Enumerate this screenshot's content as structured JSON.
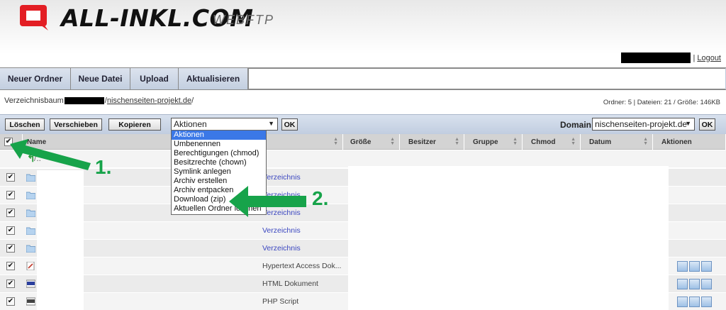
{
  "brand": {
    "name": "ALL-INKL.COM",
    "product": "WEBFTP",
    "accent": "#e31e24"
  },
  "user": {
    "separator": "|",
    "logout": "Logout"
  },
  "toolbar": [
    {
      "label": "Neuer Ordner"
    },
    {
      "label": "Neue Datei"
    },
    {
      "label": "Upload"
    },
    {
      "label": "Aktualisieren"
    }
  ],
  "path": {
    "prefix": "Verzeichnisbaum",
    "separator": "/",
    "folder": "nischenseiten-projekt.de",
    "trailing": "/"
  },
  "stats": "Ordner: 5 | Dateien: 21 / Größe: 146KB",
  "actions": {
    "delete": "Löschen",
    "move": "Verschieben",
    "copy": "Kopieren",
    "select_value": "Aktionen",
    "ok": "OK",
    "domain_label": "Domain:",
    "domain_value": "nischenseiten-projekt.de",
    "domain_ok": "OK"
  },
  "dropdown": {
    "options": [
      "Aktionen",
      "Umbenennen",
      "Berechtigungen (chmod)",
      "Besitzrechte (chown)",
      "Symlink anlegen",
      "Archiv erstellen",
      "Archiv entpacken",
      "Download (zip)",
      "Aktuellen Ordner löschen"
    ],
    "selected_index": 0
  },
  "columns": [
    "Name",
    "Größe",
    "Besitzer",
    "Gruppe",
    "Chmod",
    "Datum",
    "Aktionen"
  ],
  "up_row": "/..",
  "rows": [
    {
      "type": "Verzeichnis",
      "icon": "folder-icon",
      "link": true,
      "checked": true
    },
    {
      "type": "Verzeichnis",
      "icon": "folder-icon",
      "link": true,
      "checked": true
    },
    {
      "type": "Verzeichnis",
      "icon": "folder-icon",
      "link": true,
      "checked": true
    },
    {
      "type": "Verzeichnis",
      "icon": "folder-icon",
      "link": true,
      "checked": true
    },
    {
      "type": "Verzeichnis",
      "icon": "folder-icon",
      "link": true,
      "checked": true
    },
    {
      "type": "Hypertext Access Dok...",
      "icon": "htaccess-file-icon",
      "link": false,
      "checked": true
    },
    {
      "type": "HTML Dokument",
      "icon": "html-file-icon",
      "link": false,
      "checked": true
    },
    {
      "type": "PHP Script",
      "icon": "php-file-icon",
      "link": false,
      "checked": true
    }
  ],
  "annotations": [
    {
      "label": "1.",
      "color": "#17a34a"
    },
    {
      "label": "2.",
      "color": "#17a34a"
    }
  ]
}
